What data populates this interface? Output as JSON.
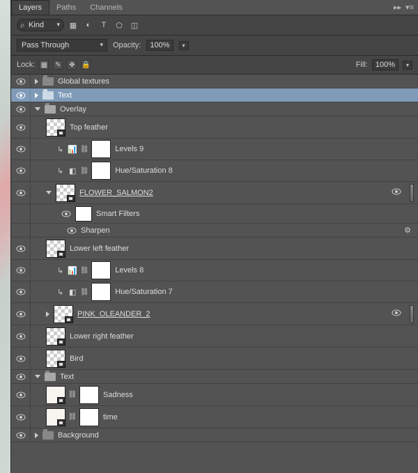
{
  "tabs": {
    "layers": "Layers",
    "paths": "Paths",
    "channels": "Channels"
  },
  "filter": {
    "kind_label": "Kind"
  },
  "blend": {
    "mode": "Pass Through",
    "opacity_label": "Opacity:",
    "opacity_value": "100%"
  },
  "lock": {
    "label": "Lock:",
    "fill_label": "Fill:",
    "fill_value": "100%"
  },
  "layers": {
    "global_textures": "Global textures",
    "text_group_top": "Text",
    "overlay": "Overlay",
    "top_feather": "Top feather",
    "levels9": "Levels 9",
    "hue8": "Hue/Saturation 8",
    "flower_salmon2": "FLOWER_SALMON2",
    "smart_filters": "Smart Filters",
    "sharpen": "Sharpen",
    "lower_left_feather": "Lower left feather",
    "levels8": "Levels 8",
    "hue7": "Hue/Saturation 7",
    "pink_oleander2": "PINK_OLEANDER_2",
    "lower_right_feather": "Lower right feather",
    "bird": "Bird",
    "text_group_bottom": "Text",
    "sadness": "Sadness",
    "time": "time",
    "background": "Background"
  }
}
